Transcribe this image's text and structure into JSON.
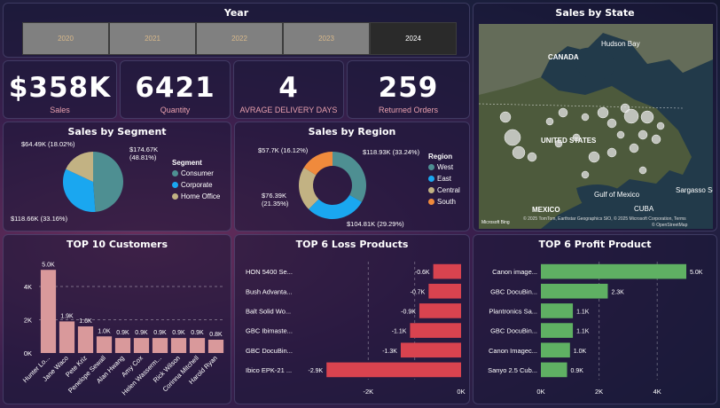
{
  "year_slicer": {
    "title": "Year",
    "years": [
      "2020",
      "2021",
      "2022",
      "2023",
      "2024"
    ],
    "selected": "2024"
  },
  "kpis": {
    "sales": {
      "value": "$358K",
      "label": "Sales"
    },
    "quantity": {
      "value": "6421",
      "label": "Quantity"
    },
    "delivery": {
      "value": "4",
      "label": "AVRAGE DELIVERY DAYS"
    },
    "returns": {
      "value": "259",
      "label": "Returned Orders"
    }
  },
  "map": {
    "title": "Sales by State",
    "labels": {
      "hudson_bay": "Hudson Bay",
      "canada": "CANADA",
      "united_states": "UNITED STATES",
      "gulf_of_mexico": "Gulf of Mexico",
      "mexico": "MEXICO",
      "cuba": "CUBA",
      "sargasso_sea": "Sargasso Sea"
    },
    "attribution": "© 2025 TomTom, Earthstar Geographics SIO, © 2025 Microsoft Corporation, Terms",
    "logo_text": "Microsoft Bing",
    "osm_text": "© OpenStreetMap"
  },
  "segment": {
    "title": "Sales by Segment",
    "legend_title": "Segment",
    "items": [
      {
        "name": "Consumer",
        "color": "#4e8f92"
      },
      {
        "name": "Corporate",
        "color": "#1aa7f0"
      },
      {
        "name": "Home Office",
        "color": "#c2b283"
      }
    ],
    "chart_data": {
      "type": "pie",
      "categories": [
        "Consumer",
        "Corporate",
        "Home Office"
      ],
      "values": [
        174.67,
        118.66,
        64.49
      ],
      "labels": [
        "$174.67K (48.81%)",
        "$118.66K (33.16%)",
        "$64.49K (18.02%)"
      ]
    }
  },
  "region": {
    "title": "Sales by Region",
    "legend_title": "Region",
    "items": [
      {
        "name": "West",
        "color": "#4e8f92"
      },
      {
        "name": "East",
        "color": "#1aa7f0"
      },
      {
        "name": "Central",
        "color": "#c2b283"
      },
      {
        "name": "South",
        "color": "#f08a3c"
      }
    ],
    "chart_data": {
      "type": "pie",
      "categories": [
        "West",
        "East",
        "Central",
        "South"
      ],
      "values": [
        118.93,
        104.81,
        76.39,
        57.7
      ],
      "labels": [
        "$118.93K (33.24%)",
        "$104.81K (29.29%)",
        "$76.39K (21.35%)",
        "$57.7K (16.12%)"
      ]
    }
  },
  "customers": {
    "title": "TOP 10 Customers",
    "chart_data": {
      "type": "bar",
      "categories": [
        "Hunter Lo...",
        "Jane Waco",
        "Pete Kriz",
        "Penelope Sewall",
        "Alan Hwang",
        "Amy Cox",
        "Helen Wasserm...",
        "Rick Wilson",
        "Corinna Mitchell",
        "Harold Ryan"
      ],
      "values": [
        5.0,
        1.9,
        1.6,
        1.0,
        0.9,
        0.9,
        0.9,
        0.9,
        0.9,
        0.8
      ],
      "data_labels": [
        "5.0K",
        "1.9K",
        "1.6K",
        "1.0K",
        "0.9K",
        "0.9K",
        "0.9K",
        "0.9K",
        "0.9K",
        "0.8K"
      ],
      "y_ticks": [
        "0K",
        "2K",
        "4K"
      ],
      "ylim": [
        0,
        5.6
      ],
      "color": "#d9999b"
    }
  },
  "loss": {
    "title": "TOP 6 Loss Products",
    "chart_data": {
      "type": "bar",
      "categories": [
        "HON 5400 Se...",
        "Bush Advanta...",
        "Balt Solid Wo...",
        "GBC Ibimaste...",
        "GBC DocuBin...",
        "Ibico EPK-21 ..."
      ],
      "values": [
        -0.6,
        -0.7,
        -0.9,
        -1.1,
        -1.3,
        -2.9
      ],
      "data_labels": [
        "-0.6K",
        "-0.7K",
        "-0.9K",
        "-1.1K",
        "-1.3K",
        "-2.9K"
      ],
      "x_ticks": [
        "-2K",
        "0K"
      ],
      "xlim": [
        -3.0,
        0
      ],
      "color": "#d9434f"
    }
  },
  "profit": {
    "title": "TOP 6 Profit Product",
    "chart_data": {
      "type": "bar",
      "categories": [
        "Canon image...",
        "GBC DocuBin...",
        "Plantronics Sa...",
        "GBC DocuBin...",
        "Canon Imagec...",
        "Sanyo 2.5 Cub..."
      ],
      "values": [
        5.0,
        2.3,
        1.1,
        1.1,
        1.0,
        0.9
      ],
      "data_labels": [
        "5.0K",
        "2.3K",
        "1.1K",
        "1.1K",
        "1.0K",
        "0.9K"
      ],
      "x_ticks": [
        "0K",
        "2K",
        "4K"
      ],
      "xlim": [
        0,
        5.0
      ],
      "color": "#5fb063"
    }
  }
}
